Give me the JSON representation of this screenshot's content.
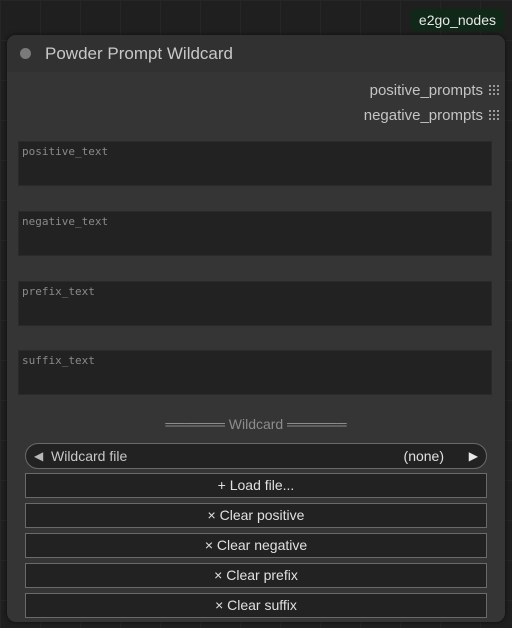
{
  "badge": {
    "label": "e2go_nodes"
  },
  "node": {
    "title": "Powder Prompt Wildcard",
    "outputs": [
      {
        "label": "positive_prompts"
      },
      {
        "label": "negative_prompts"
      }
    ],
    "text_fields": {
      "positive_text": {
        "placeholder": "positive_text",
        "value": ""
      },
      "negative_text": {
        "placeholder": "negative_text",
        "value": ""
      },
      "prefix_text": {
        "placeholder": "prefix_text",
        "value": ""
      },
      "suffix_text": {
        "placeholder": "suffix_text",
        "value": ""
      }
    },
    "divider": "══════ Wildcard ══════",
    "wildcard_combo": {
      "label": "Wildcard file",
      "value": "(none)",
      "left_arrow": "◀",
      "right_arrow": "▶"
    },
    "buttons": {
      "load_file": "+ Load file...",
      "clear_positive": "× Clear positive",
      "clear_negative": "× Clear negative",
      "clear_prefix": "× Clear prefix",
      "clear_suffix": "× Clear suffix"
    }
  },
  "colors": {
    "canvas": "#1f1f1f",
    "node_body": "#353535",
    "node_header": "#313131",
    "badge_bg": "#0f2818",
    "widget_bg": "#222222",
    "widget_border": "#6a6a6a"
  }
}
